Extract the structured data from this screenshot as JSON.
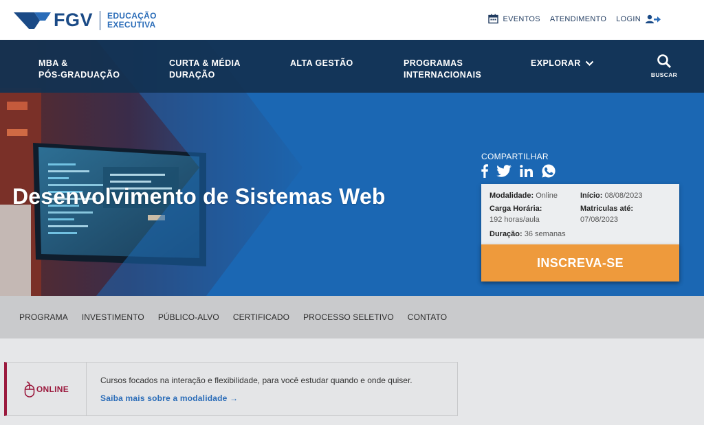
{
  "brand": {
    "name": "FGV",
    "subtitle_line1": "EDUCAÇÃO",
    "subtitle_line2": "EXECUTIVA",
    "primary_color": "#1a4a86",
    "accent_color": "#2a6cb8"
  },
  "top_links": {
    "eventos": "EVENTOS",
    "atendimento": "ATENDIMENTO",
    "login": "LOGIN"
  },
  "nav": {
    "items": [
      {
        "line1": "MBA &",
        "line2": "PÓS-GRADUAÇÃO"
      },
      {
        "line1": "CURTA & MÉDIA",
        "line2": "DURAÇÃO"
      },
      {
        "line1": "ALTA GESTÃO",
        "line2": ""
      },
      {
        "line1": "PROGRAMAS",
        "line2": "INTERNACIONAIS"
      }
    ],
    "explorar": "EXPLORAR",
    "buscar": "BUSCAR"
  },
  "hero": {
    "title": "Desenvolvimento de Sistemas Web",
    "background_color": "#1b67b3"
  },
  "share": {
    "label": "COMPARTILHAR",
    "icons": [
      "facebook-icon",
      "twitter-icon",
      "linkedin-icon",
      "whatsapp-icon"
    ]
  },
  "course_info": {
    "modalidade_label": "Modalidade:",
    "modalidade_value": "Online",
    "inicio_label": "Início:",
    "inicio_value": "08/08/2023",
    "carga_label": "Carga Horária:",
    "carga_value": "192 horas/aula",
    "matriculas_label": "Matriculas até:",
    "matriculas_value": "07/08/2023",
    "duracao_label": "Duração:",
    "duracao_value": "36 semanas"
  },
  "cta": {
    "label": "INSCREVA-SE",
    "color": "#ee9a3c"
  },
  "subnav": {
    "items": [
      "PROGRAMA",
      "INVESTIMENTO",
      "PÚBLICO-ALVO",
      "CERTIFICADO",
      "PROCESSO SELETIVO",
      "CONTATO"
    ]
  },
  "notice": {
    "badge": "ONLINE",
    "text": "Cursos focados na interação e flexibilidade, para você estudar quando e onde quiser.",
    "link": "Saiba mais sobre a modalidade →",
    "accent_color": "#9b1a3e"
  }
}
